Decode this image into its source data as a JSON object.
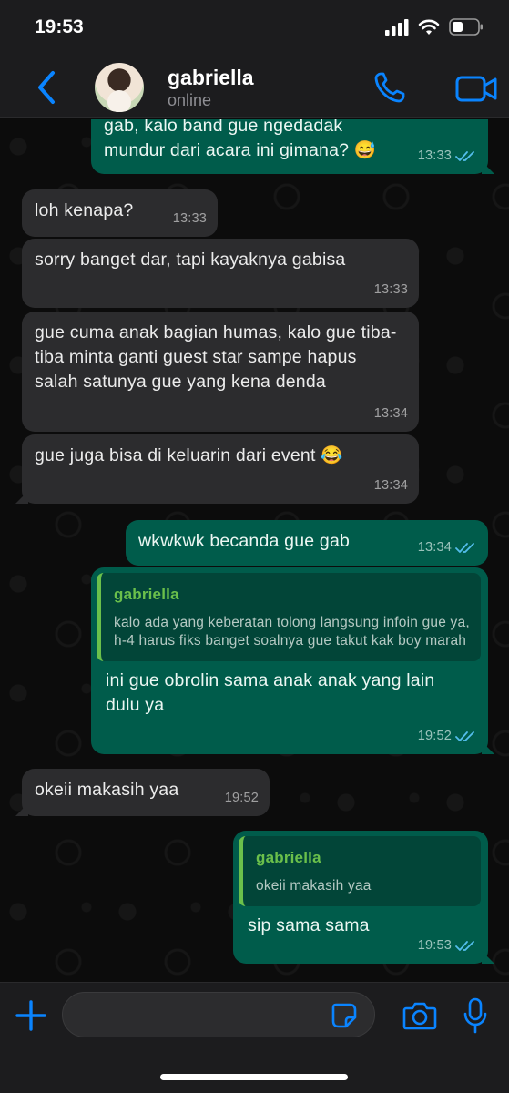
{
  "status_bar": {
    "time": "19:53"
  },
  "header": {
    "contact_name": "gabriella",
    "contact_status": "online"
  },
  "messages": [
    {
      "direction": "out",
      "text": "gab, kalo band gue ngedadak mundur dari acara ini gimana? 😅",
      "time": "13:33",
      "read": true
    },
    {
      "direction": "in",
      "text": "loh kenapa?",
      "time": "13:33"
    },
    {
      "direction": "in",
      "text": "sorry banget dar, tapi kayaknya gabisa",
      "time": "13:33"
    },
    {
      "direction": "in",
      "text": "gue cuma anak bagian humas, kalo gue tiba-tiba minta ganti guest star sampe hapus salah satunya gue yang kena denda",
      "time": "13:34"
    },
    {
      "direction": "in",
      "text": "gue juga bisa di keluarin dari event 😂",
      "time": "13:34"
    },
    {
      "direction": "out",
      "text": "wkwkwk becanda gue gab",
      "time": "13:34",
      "read": true
    },
    {
      "direction": "out",
      "quote_author": "gabriella",
      "quote_text": "kalo ada yang keberatan tolong langsung infoin gue ya, h-4 harus fiks banget soalnya gue takut kak boy marah",
      "text": "ini gue obrolin sama anak anak yang lain dulu ya",
      "time": "19:52",
      "read": true
    },
    {
      "direction": "in",
      "text": "okeii makasih yaa",
      "time": "19:52"
    },
    {
      "direction": "out",
      "quote_author": "gabriella",
      "quote_text": "okeii makasih yaa",
      "text": "sip sama sama",
      "time": "19:53",
      "read": true
    }
  ],
  "input": {
    "placeholder": "",
    "value": ""
  },
  "colors": {
    "outgoing_bubble": "#005c4b",
    "incoming_bubble": "#2c2c2e",
    "accent_blue": "#0a84ff",
    "read_ticks": "#53bdeb",
    "quote_author": "#6bc04b"
  },
  "icons": [
    "back-chevron-icon",
    "phone-icon",
    "video-camera-icon",
    "plus-icon",
    "sticker-icon",
    "camera-icon",
    "microphone-icon",
    "double-check-icon"
  ]
}
